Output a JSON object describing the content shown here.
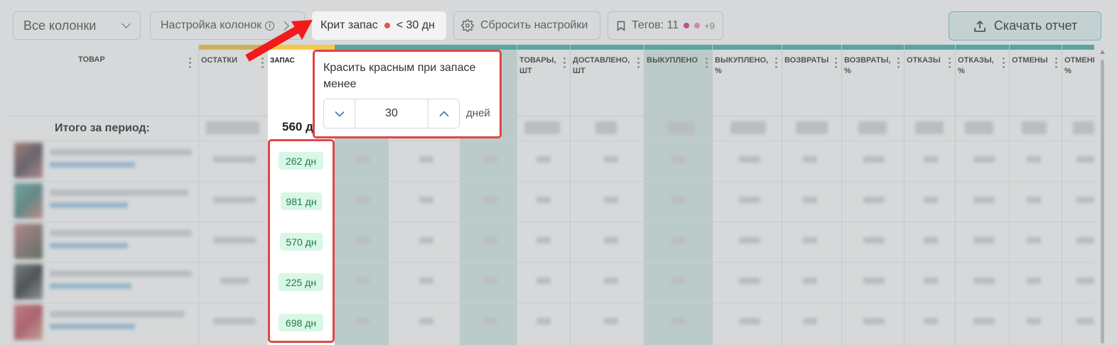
{
  "toolbar": {
    "columns_select": "Все колонки",
    "columns_setup": "Настройка колонок",
    "crit_label": "Крит запас",
    "crit_value": "< 30 дн",
    "reset_label": "Сбросить настройки",
    "tags_label": "Тегов: 11",
    "tags_more": "+9",
    "download_label": "Скачать отчет",
    "colors": {
      "accent_teal": "#4db6ac",
      "crit_dot": "#e5534b",
      "tag_dot_1": "#d63ea0",
      "tag_dot_2": "#f08fc3"
    }
  },
  "table": {
    "product_header": "ТОВАР",
    "total_label": "Итого за период:",
    "columns": [
      "ОСТАТКИ",
      "ЗАПАС",
      "ТОВАРЫ, ШТ",
      "ДОСТАВЛЕНО, ШТ",
      "ВЫКУПЛЕНО",
      "ВЫКУПЛЕНО, %",
      "ВОЗВРАТЫ",
      "ВОЗВРАТЫ, %",
      "ОТКАЗЫ",
      "ОТКАЗЫ, %",
      "ОТМЕНЫ",
      "ОТМЕНЫ, %"
    ],
    "zapas_total": "560 д",
    "zapas_values": [
      "262 дн",
      "981 дн",
      "570 дн",
      "225 дн",
      "698 дн"
    ]
  },
  "popup": {
    "title": "Красить красным при запасе менее",
    "value": "30",
    "unit": "дней"
  }
}
